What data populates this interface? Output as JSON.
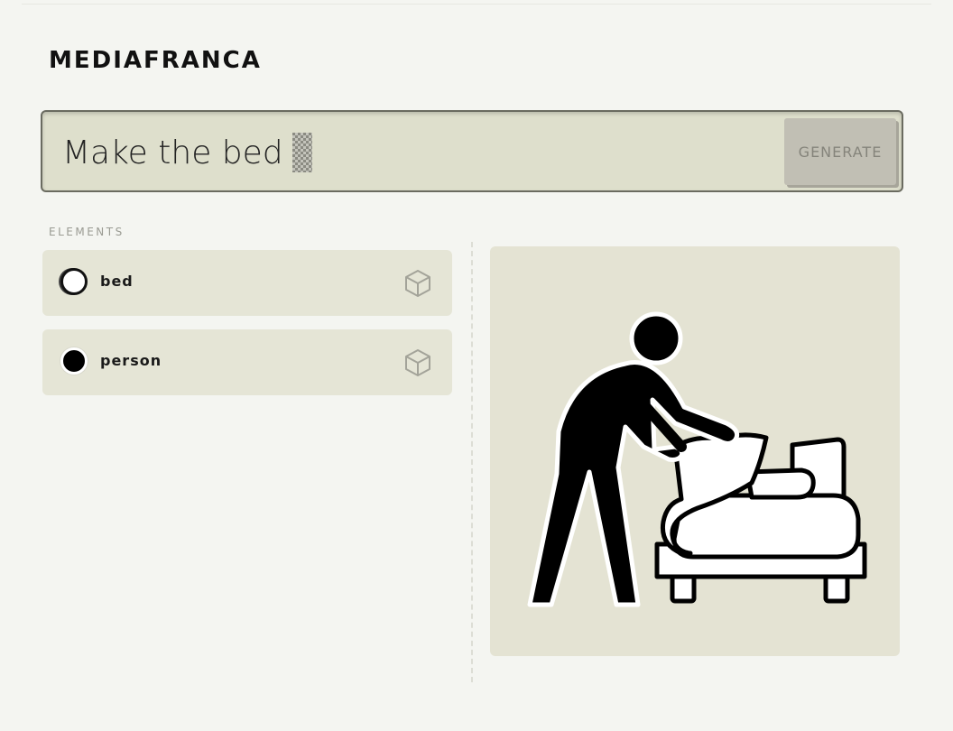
{
  "app": {
    "logo": "MEDIAFRANCA"
  },
  "prompt": {
    "value": "Make the bed",
    "generate_label": "GENERATE"
  },
  "elements_section": {
    "title": "ELEMENTS",
    "items": [
      {
        "name": "bed",
        "color": "#ffffff",
        "icon": "cube-icon"
      },
      {
        "name": "person",
        "color": "#000000",
        "icon": "cube-icon"
      }
    ]
  },
  "preview": {
    "icon": "person-making-bed-pictogram"
  }
}
